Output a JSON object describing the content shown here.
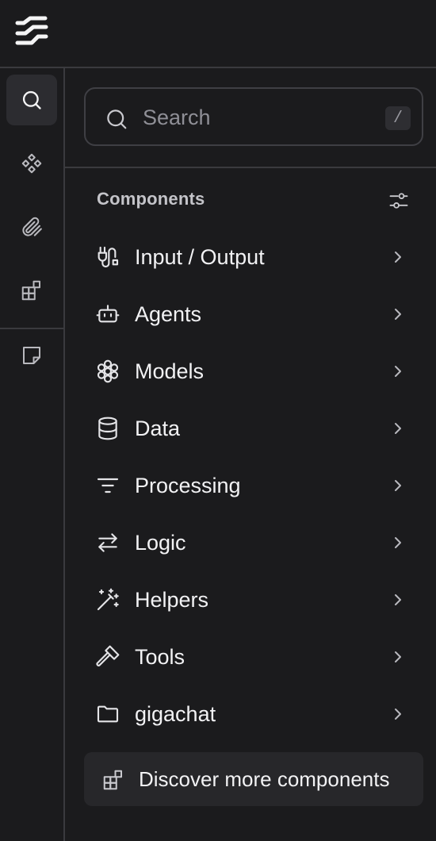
{
  "app": {
    "logo_icon": "langflow-logo-icon"
  },
  "rail": {
    "items": [
      {
        "icon": "search-icon",
        "active": true
      },
      {
        "icon": "components-icon",
        "active": false
      },
      {
        "icon": "paperclip-icon",
        "active": false
      },
      {
        "icon": "blocks-icon",
        "active": false
      },
      {
        "icon": "sticky-note-icon",
        "active": false
      }
    ]
  },
  "search": {
    "placeholder": "Search",
    "shortcut": "/"
  },
  "components": {
    "title": "Components",
    "categories": [
      {
        "label": "Input / Output",
        "icon": "io-icon"
      },
      {
        "label": "Agents",
        "icon": "bot-icon"
      },
      {
        "label": "Models",
        "icon": "brain-icon"
      },
      {
        "label": "Data",
        "icon": "database-icon"
      },
      {
        "label": "Processing",
        "icon": "list-filter-icon"
      },
      {
        "label": "Logic",
        "icon": "arrow-left-right-icon"
      },
      {
        "label": "Helpers",
        "icon": "wand-icon"
      },
      {
        "label": "Tools",
        "icon": "hammer-icon"
      },
      {
        "label": "gigachat",
        "icon": "folder-icon"
      }
    ]
  },
  "discover": {
    "label": "Discover more components",
    "icon": "blocks-icon"
  },
  "colors": {
    "background": "#1b1b1d",
    "border": "#3a3a3e",
    "active": "#2c2c30",
    "text": "#f4f4f5",
    "muted": "#8f8f96"
  }
}
